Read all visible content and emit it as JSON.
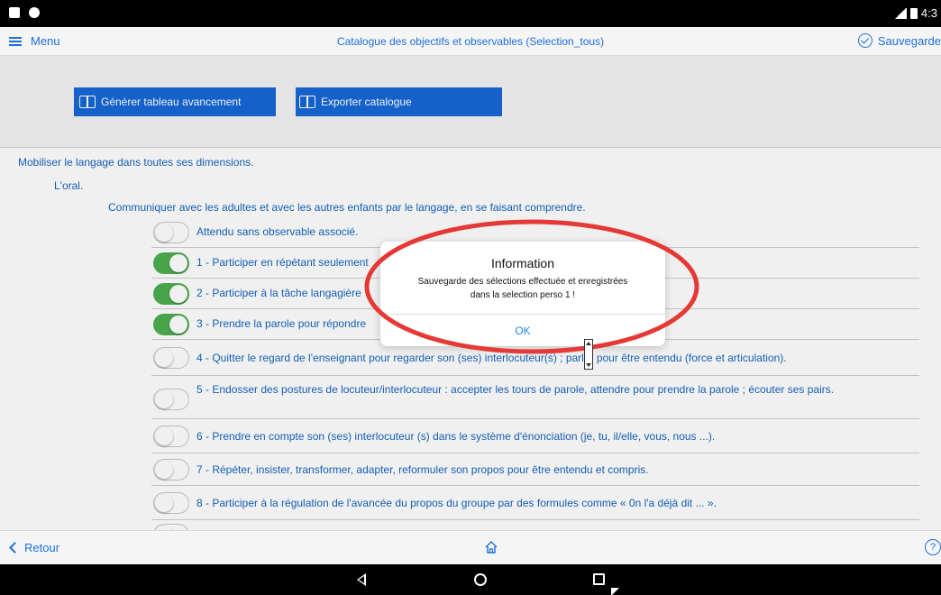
{
  "status_bar": {
    "time": "4:3"
  },
  "header": {
    "menu_label": "Menu",
    "title": "Catalogue des objectifs et observables (Selection_tous)",
    "save_label": "Sauvegarde"
  },
  "actions": {
    "generate_label": "Générer tableau avancement",
    "export_label": "Exporter catalogue"
  },
  "content": {
    "domain": "Mobiliser le langage dans toutes ses dimensions.",
    "subdomain": "L'oral.",
    "objective": "Communiquer avec les adultes et avec les autres enfants par le langage, en se faisant comprendre.",
    "items": [
      {
        "label": "Attendu sans observable associé.",
        "on": false
      },
      {
        "label": "1 - Participer en répétant seulement",
        "on": true
      },
      {
        "label": "2 - Participer à la tâche langagière",
        "on": true
      },
      {
        "label": "3 - Prendre la parole pour répondre",
        "on": true
      },
      {
        "label": "4 - Quitter le regard de l'enseignant pour regarder son (ses) interlocuteur(s) ; parler pour être entendu (force et articulation).",
        "on": false
      },
      {
        "label": "5 - Endosser des postures de locuteur/interlocuteur : accepter les tours de parole, attendre pour prendre la parole ; écouter ses pairs.",
        "on": false
      },
      {
        "label": "6 - Prendre en compte son (ses) interlocuteur (s) dans le système d'énonciation (je, tu, il/elle, vous, nous ...).",
        "on": false
      },
      {
        "label": "7 - Répéter, insister, transformer, adapter, reformuler son propos pour être entendu et compris.",
        "on": false
      },
      {
        "label": "8 - Participer à la régulation de l'avancée du propos du groupe par des formules comme « 0n l'a déjà dit ... ».",
        "on": false
      }
    ]
  },
  "footer": {
    "back_label": "Retour",
    "help_glyph": "?"
  },
  "dialog": {
    "title": "Information",
    "message_line1": "Sauvegarde des sélections effectuée et enregistrées",
    "message_line2": "dans la selection perso 1 !",
    "ok_label": "OK"
  },
  "colors": {
    "accent": "#1668d6",
    "link": "#1565c0",
    "toggle_on": "#4caf50",
    "annotation": "#e53935"
  }
}
